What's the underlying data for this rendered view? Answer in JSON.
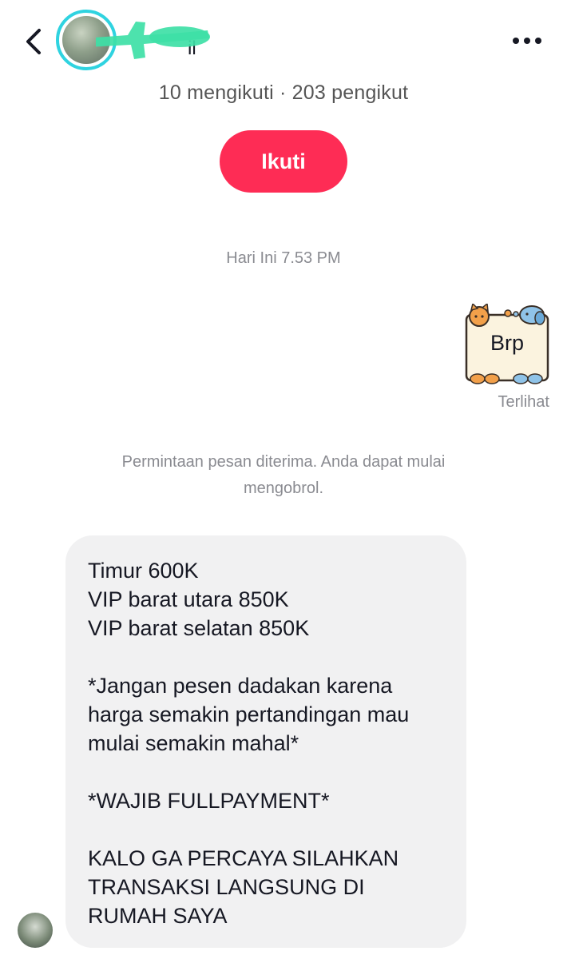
{
  "header": {
    "back_icon": "chevron-left-icon",
    "more_icon": "more-horizontal-icon",
    "name_partial": "il"
  },
  "profile": {
    "follow_stats": "10 mengikuti · 203 pengikut",
    "follow_button_label": "Ikuti"
  },
  "chat": {
    "timestamp": "Hari Ini 7.53 PM",
    "sent_sticker_text": "Brp",
    "seen_status": "Terlihat",
    "system_message": "Permintaan pesan diterima. Anda dapat mulai mengobrol.",
    "incoming_message_lines": [
      "Timur 600K",
      "VIP barat utara 850K",
      "VIP barat selatan 850K",
      "",
      "*Jangan pesen dadakan karena",
      "harga semakin pertandingan mau",
      "mulai semakin mahal*",
      "",
      "*WAJIB FULLPAYMENT*",
      "",
      "KALO GA PERCAYA SILAHKAN",
      "TRANSAKSI LANGSUNG DI",
      "RUMAH SAYA"
    ]
  },
  "colors": {
    "accent": "#fe2c55",
    "avatar_ring": "#2fd3e0",
    "redaction": "#3ee0a6",
    "bubble_bg": "#f1f1f2",
    "muted_text": "#8a8b91"
  }
}
